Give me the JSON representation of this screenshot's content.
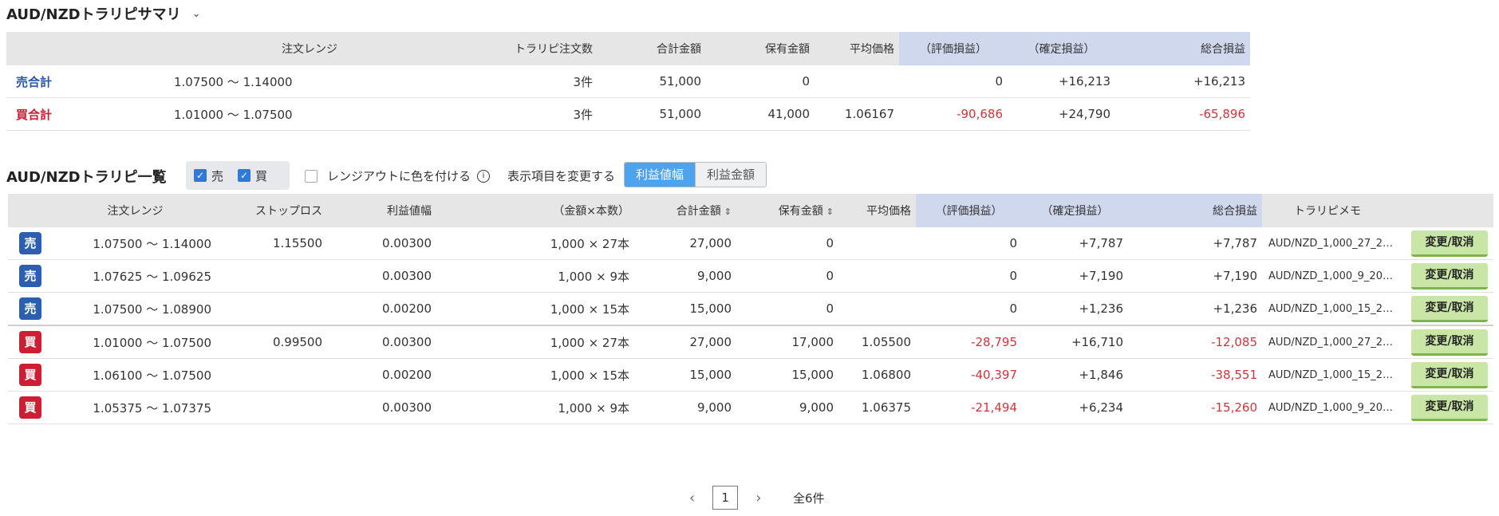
{
  "summary": {
    "title": "AUD/NZDトラリピサマリ",
    "chevron": "⌄",
    "headers": [
      "注文レンジ",
      "トラリピ注文数",
      "合計金額",
      "保有金額",
      "平均価格",
      "（評価損益）",
      "（確定損益）",
      "総合損益"
    ],
    "rows": [
      {
        "label": "売合計",
        "range": "1.07500 〜 1.14000",
        "count": "3件",
        "total": "51,000",
        "held": "0",
        "avg": "",
        "unreal": "0",
        "realized": "+16,213",
        "net": "+16,213"
      },
      {
        "label": "買合計",
        "range": "1.01000 〜 1.07500",
        "count": "3件",
        "total": "51,000",
        "held": "41,000",
        "avg": "1.06167",
        "unreal": "-90,686",
        "realized": "+24,790",
        "net": "-65,896"
      }
    ]
  },
  "list": {
    "title": "AUD/NZDトラリピ一覧",
    "filter_sell": "売",
    "filter_buy": "買",
    "range_color_label": "レンジアウトに色を付ける",
    "info_icon": "i",
    "display_label": "表示項目を変更する",
    "toggle_active": "利益値幅",
    "toggle_inactive": "利益金額",
    "headers": [
      "注文レンジ",
      "ストップロス",
      "利益値幅",
      "（金額×本数）",
      "合計金額",
      "保有金額",
      "平均価格",
      "（評価損益）",
      "（確定損益）",
      "総合損益",
      "トラリピメモ"
    ],
    "sort_icon": "⇕",
    "button_label": "変更/取消",
    "rows": [
      {
        "side": "売",
        "range": "1.07500 〜 1.14000",
        "stop": "1.15500",
        "width": "0.00300",
        "qty": "1,000 × 27本",
        "total": "27,000",
        "held": "0",
        "avg": "",
        "unreal": "0",
        "realized": "+7,787",
        "net": "+7,787",
        "memo": "AUD/NZD_1,000_27_2…"
      },
      {
        "side": "売",
        "range": "1.07625 〜 1.09625",
        "stop": "",
        "width": "0.00300",
        "qty": "1,000 × 9本",
        "total": "9,000",
        "held": "0",
        "avg": "",
        "unreal": "0",
        "realized": "+7,190",
        "net": "+7,190",
        "memo": "AUD/NZD_1,000_9_20…"
      },
      {
        "side": "売",
        "range": "1.07500 〜 1.08900",
        "stop": "",
        "width": "0.00200",
        "qty": "1,000 × 15本",
        "total": "15,000",
        "held": "0",
        "avg": "",
        "unreal": "0",
        "realized": "+1,236",
        "net": "+1,236",
        "memo": "AUD/NZD_1,000_15_2…"
      },
      {
        "side": "買",
        "range": "1.01000 〜 1.07500",
        "stop": "0.99500",
        "width": "0.00300",
        "qty": "1,000 × 27本",
        "total": "27,000",
        "held": "17,000",
        "avg": "1.05500",
        "unreal": "-28,795",
        "realized": "+16,710",
        "net": "-12,085",
        "memo": "AUD/NZD_1,000_27_2…"
      },
      {
        "side": "買",
        "range": "1.06100 〜 1.07500",
        "stop": "",
        "width": "0.00200",
        "qty": "1,000 × 15本",
        "total": "15,000",
        "held": "15,000",
        "avg": "1.06800",
        "unreal": "-40,397",
        "realized": "+1,846",
        "net": "-38,551",
        "memo": "AUD/NZD_1,000_15_2…"
      },
      {
        "side": "買",
        "range": "1.05375 〜 1.07375",
        "stop": "",
        "width": "0.00300",
        "qty": "1,000 × 9本",
        "total": "9,000",
        "held": "9,000",
        "avg": "1.06375",
        "unreal": "-21,494",
        "realized": "+6,234",
        "net": "-15,260",
        "memo": "AUD/NZD_1,000_9_20…"
      }
    ]
  },
  "pager": {
    "prev": "‹",
    "page": "1",
    "next": "›",
    "total": "全6件"
  },
  "colors": {
    "sell": "#2d5fb0",
    "buy": "#cc1f33",
    "negative": "#d4323a",
    "toggle_active": "#4da3ee",
    "button": "#c9e6a6"
  }
}
